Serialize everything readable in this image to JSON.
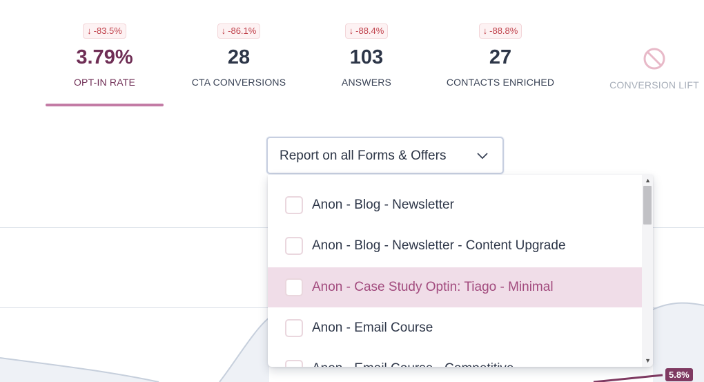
{
  "stats": [
    {
      "delta": "-83.5%",
      "value": "3.79%",
      "label": "OPT-IN RATE"
    },
    {
      "delta": "-86.1%",
      "value": "28",
      "label": "CTA CONVERSIONS"
    },
    {
      "delta": "-88.4%",
      "value": "103",
      "label": "ANSWERS"
    },
    {
      "delta": "-88.8%",
      "value": "27",
      "label": "CONTACTS ENRICHED"
    }
  ],
  "conversion_lift": {
    "label": "CONVERSION LIFT",
    "icon": "prohibited-icon"
  },
  "delta_arrow": "↓",
  "select": {
    "value": "Report on all Forms & Offers"
  },
  "options": [
    "Anon - Blog - Newsletter",
    "Anon - Blog - Newsletter - Content Upgrade",
    "Anon - Case Study Optin: Tiago - Minimal",
    "Anon - Email Course",
    "Anon - Email Course - Competitive"
  ],
  "highlighted_option": "Anon - Case Study Optin: Tiago - Minimal",
  "chart_tag": "5.8%",
  "colors": {
    "accent": "#c37ba5",
    "delta": "#c0414b",
    "highlight": "#f0dde8"
  }
}
